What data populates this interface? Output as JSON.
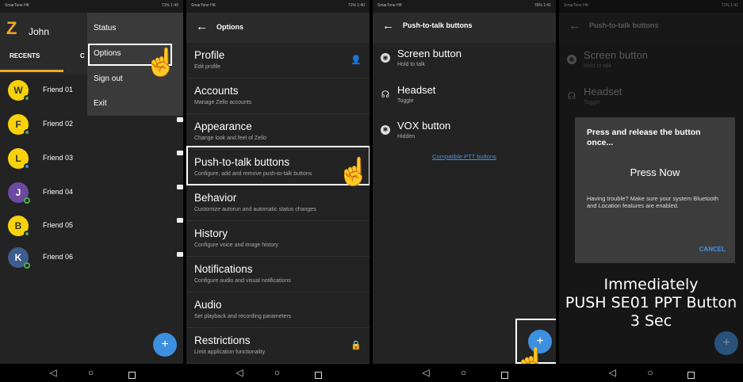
{
  "status": {
    "carrier": "SmarTone HK",
    "right_1": "71% 1:40",
    "right_2": "71% 1:40",
    "right_3": "70% 1:41",
    "right_4": "71% 1:41"
  },
  "panel1": {
    "user_name": "John",
    "tab_recents": "RECENTS",
    "tab_other": "C",
    "friends": [
      {
        "initial": "W",
        "name": "Friend 01"
      },
      {
        "initial": "F",
        "name": "Friend 02"
      },
      {
        "initial": "L",
        "name": "Friend 03"
      },
      {
        "initial": "J",
        "name": "Friend 04"
      },
      {
        "initial": "B",
        "name": "Friend 05"
      },
      {
        "initial": "K",
        "name": "Friend 06"
      }
    ],
    "menu": [
      "Status",
      "Options",
      "Sign out",
      "Exit"
    ]
  },
  "panel2": {
    "title": "Options",
    "items": [
      {
        "title": "Profile",
        "sub": "Edit profile"
      },
      {
        "title": "Accounts",
        "sub": "Manage Zello accounts"
      },
      {
        "title": "Appearance",
        "sub": "Change look and feel of Zello"
      },
      {
        "title": "Push-to-talk buttons",
        "sub": "Configure, add and remove push-to-talk buttons"
      },
      {
        "title": "Behavior",
        "sub": "Customize autorun and automatic status changes"
      },
      {
        "title": "History",
        "sub": "Configure voice and image history"
      },
      {
        "title": "Notifications",
        "sub": "Configure audio and visual notifications"
      },
      {
        "title": "Audio",
        "sub": "Set playback and recording parameters"
      },
      {
        "title": "Restrictions",
        "sub": "Limit application functionality"
      }
    ]
  },
  "panel3": {
    "title": "Push-to-talk buttons",
    "items": [
      {
        "title": "Screen button",
        "sub": "Hold to talk"
      },
      {
        "title": "Headset",
        "sub": "Toggle"
      },
      {
        "title": "VOX button",
        "sub": "Hidden"
      }
    ],
    "link": "Compatible PTT buttons"
  },
  "panel4": {
    "title": "Push-to-talk buttons",
    "dialog": {
      "title": "Press and release the button once...",
      "press": "Press Now",
      "message": "Having trouble? Make sure your system Bluetooth and Location features are enabled.",
      "cancel": "CANCEL"
    },
    "caption_1": "Immediately",
    "caption_2": "PUSH SE01 PPT Button",
    "caption_3": "3 Sec"
  },
  "colors": {
    "accent": "#f5a623",
    "fab": "#3d8fe0",
    "link": "#4a90e2"
  }
}
